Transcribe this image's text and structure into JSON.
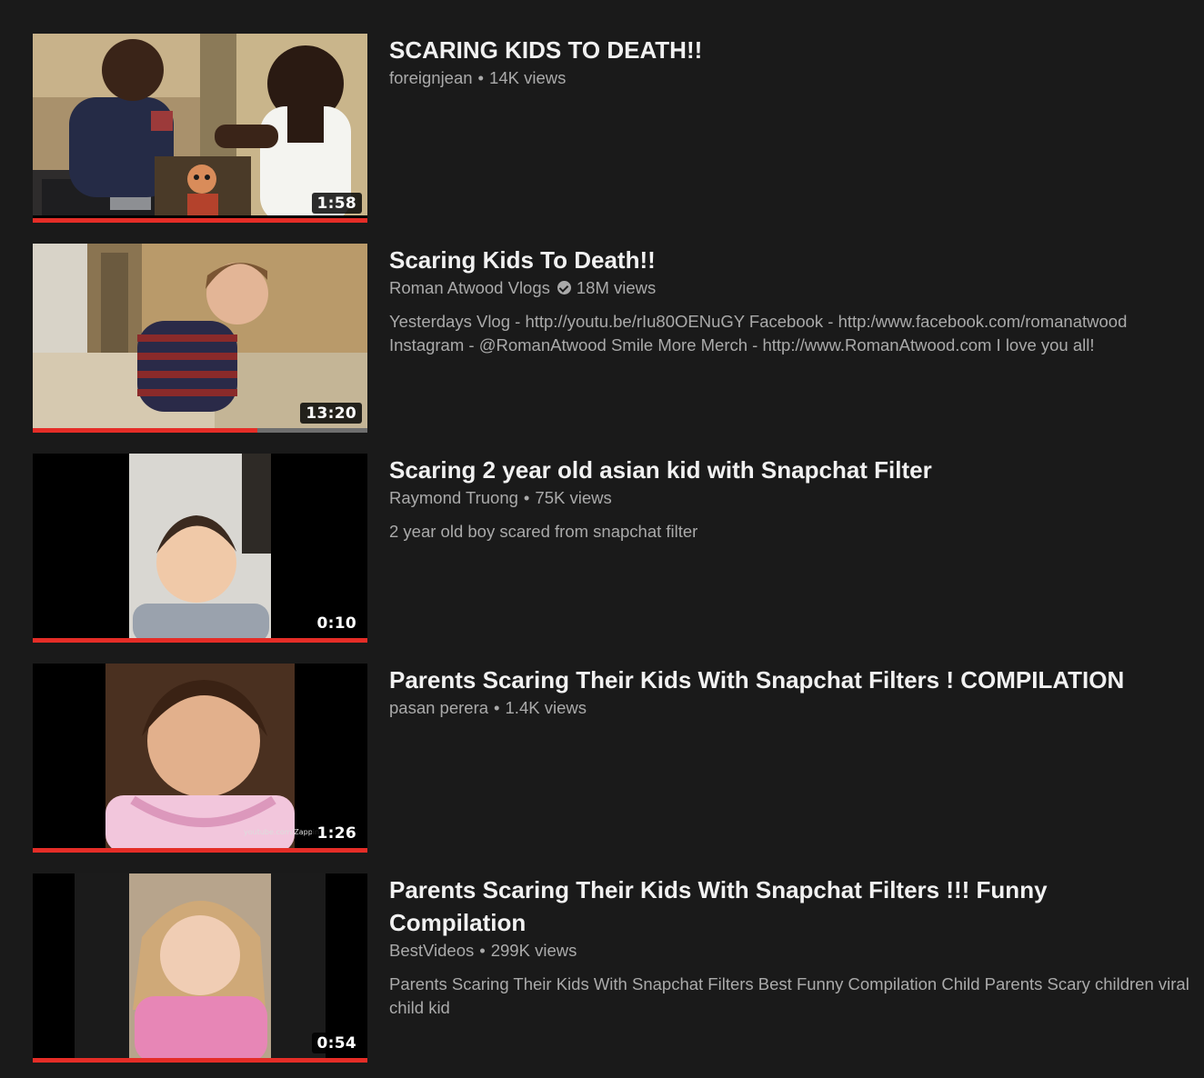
{
  "results": [
    {
      "title": "SCARING KIDS TO DEATH!!",
      "channel": "foreignjean",
      "views": "14K views",
      "verified": false,
      "description": "",
      "duration": "1:58",
      "watched_progress": 1.0,
      "thumbnail_icon": "two-kids-split-scene-with-clown"
    },
    {
      "title": "Scaring Kids To Death!!",
      "channel": "Roman Atwood Vlogs",
      "views": "18M views",
      "verified": true,
      "description": "Yesterdays Vlog - http://youtu.be/rIu80OENuGY Facebook - http:/www.facebook.com/romanatwood Instagram - @RomanAtwood Smile More Merch - http://www.RomanAtwood.com I love you all!",
      "duration": "13:20",
      "watched_progress": 0.67,
      "thumbnail_icon": "crying-boy-striped-sweater"
    },
    {
      "title": "Scaring 2 year old asian kid with Snapchat Filter",
      "channel": "Raymond Truong",
      "views": "75K views",
      "verified": false,
      "description": "2 year old boy scared from snapchat filter",
      "duration": "0:10",
      "watched_progress": 1.0,
      "thumbnail_icon": "toddler-portrait-vertical-video"
    },
    {
      "title": "Parents Scaring Their Kids With Snapchat Filters ! COMPILATION",
      "channel": "pasan perera",
      "views": "1.4K views",
      "verified": false,
      "description": "",
      "duration": "1:26",
      "watermark": "youtube.com/Zappin",
      "watched_progress": 1.0,
      "thumbnail_icon": "smiling-girl-pink-dress"
    },
    {
      "title": "Parents Scaring Their Kids With Snapchat Filters !!! Funny Compilation",
      "channel": "BestVideos",
      "views": "299K views",
      "verified": false,
      "description": "Parents Scaring Their Kids With Snapchat Filters Best Funny Compilation Child Parents Scary children viral child kid",
      "duration": "0:54",
      "watched_progress": 1.0,
      "thumbnail_icon": "blonde-girl-pink-top"
    }
  ],
  "colors": {
    "background": "#1a1a1a",
    "title": "#f1f1f1",
    "secondary_text": "#aaaaaa",
    "progress": "#e52d27"
  }
}
